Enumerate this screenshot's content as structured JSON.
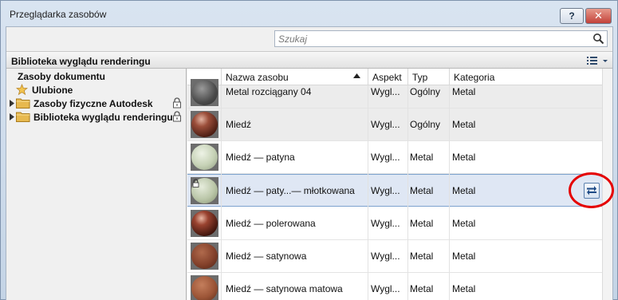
{
  "window": {
    "title": "Przeglądarka zasobów",
    "help_label": "?",
    "close_label": "✕"
  },
  "search": {
    "placeholder": "Szukaj",
    "value": "",
    "icon": "search-icon"
  },
  "library_bar": {
    "title": "Biblioteka wyglądu renderingu",
    "view_icon": "list-view-icon"
  },
  "tree": {
    "items": [
      {
        "label": "Zasoby dokumentu",
        "icon": ""
      },
      {
        "label": "Ulubione",
        "icon": "star-icon"
      },
      {
        "label": "Zasoby fizyczne Autodesk",
        "icon": "folder-icon",
        "locked": true
      },
      {
        "label": "Biblioteka wyglądu renderingu",
        "icon": "folder-icon",
        "locked": true
      }
    ]
  },
  "table": {
    "headers": {
      "name": "Nazwa zasobu",
      "aspect": "Aspekt",
      "type": "Typ",
      "category": "Kategoria"
    },
    "sort": "ascending",
    "rows": [
      {
        "name": "Metal rozciągany 04",
        "aspect": "Wygl...",
        "type": "Ogólny",
        "category": "Metal",
        "swatch": "#5a5a5a"
      },
      {
        "name": "Miedź",
        "aspect": "Wygl...",
        "type": "Ogólny",
        "category": "Metal",
        "swatch": "#8a4a37"
      },
      {
        "name": "Miedź — patyna",
        "aspect": "Wygl...",
        "type": "Metal",
        "category": "Metal",
        "swatch": "#c7d3b8"
      },
      {
        "name": "Miedź — paty...— młotkowana",
        "aspect": "Wygl...",
        "type": "Metal",
        "category": "Metal",
        "swatch": "#c1cdb0",
        "selected": true
      },
      {
        "name": "Miedź — polerowana",
        "aspect": "Wygl...",
        "type": "Metal",
        "category": "Metal",
        "swatch": "#8c3f2c"
      },
      {
        "name": "Miedź — satynowa",
        "aspect": "Wygl...",
        "type": "Metal",
        "category": "Metal",
        "swatch": "#8f4a32"
      },
      {
        "name": "Miedź — satynowa matowa",
        "aspect": "Wygl...",
        "type": "Metal",
        "category": "Metal",
        "swatch": "#a35a3c"
      }
    ]
  },
  "colors": {
    "selection": "#dfe7f4",
    "annotation": "#e50000"
  }
}
